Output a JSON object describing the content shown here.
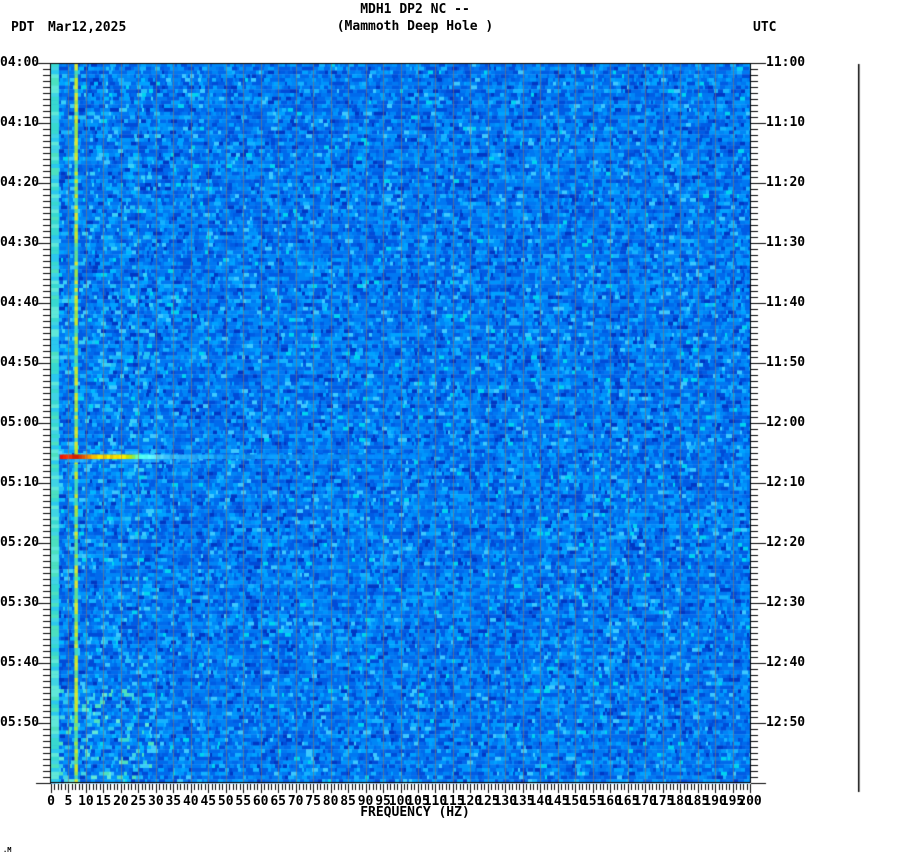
{
  "header": {
    "timezone_left": "PDT",
    "date": "Mar12,2025",
    "title": "MDH1 DP2 NC --",
    "subtitle": "(Mammoth Deep Hole )",
    "timezone_right": "UTC"
  },
  "x_axis": {
    "label": "FREQUENCY (HZ)",
    "min_hz": 0,
    "max_hz": 200,
    "major_tick_step_hz": 5,
    "minor_tick_step_hz": 1,
    "tick_labels": [
      "0",
      "5",
      "10",
      "15",
      "20",
      "25",
      "30",
      "35",
      "40",
      "45",
      "50",
      "55",
      "60",
      "65",
      "70",
      "75",
      "80",
      "85",
      "90",
      "95",
      "100",
      "105",
      "110",
      "115",
      "120",
      "125",
      "130",
      "135",
      "140",
      "145",
      "150",
      "155",
      "160",
      "165",
      "170",
      "175",
      "180",
      "185",
      "190",
      "195",
      "200"
    ]
  },
  "left_axis": {
    "timezone": "PDT",
    "major_tick_step_min": 10,
    "minor_tick_step_min": 1,
    "tick_labels": [
      "04:00",
      "04:10",
      "04:20",
      "04:30",
      "04:40",
      "04:50",
      "05:00",
      "05:10",
      "05:20",
      "05:30",
      "05:40",
      "05:50"
    ]
  },
  "right_axis": {
    "timezone": "UTC",
    "major_tick_step_min": 10,
    "minor_tick_step_min": 1,
    "tick_labels": [
      "11:00",
      "11:10",
      "11:20",
      "11:30",
      "11:40",
      "11:50",
      "12:00",
      "12:10",
      "12:20",
      "12:30",
      "12:40",
      "12:50"
    ]
  },
  "corner_text": ".M",
  "chart_data": {
    "type": "heatmap",
    "subtype": "seismic spectrogram",
    "title": "MDH1 DP2 NC --",
    "station": "(Mammoth Deep Hole )",
    "xlabel": "FREQUENCY (HZ)",
    "x_range_hz": [
      0,
      200
    ],
    "time_start_pdt": "04:00",
    "time_end_pdt": "06:00",
    "time_start_utc": "11:00",
    "time_end_utc": "13:00",
    "time_span_minutes": 120,
    "legend_position": "none",
    "grid": {
      "x_interval_hz": 5,
      "color": "#91795f"
    },
    "noise_palette": [
      [
        "#0038c4",
        1.5
      ],
      [
        "#004cd8",
        3
      ],
      [
        "#005ce4",
        5
      ],
      [
        "#006aec",
        6
      ],
      [
        "#0078f2",
        6
      ],
      [
        "#0086f6",
        5
      ],
      [
        "#0094fb",
        4
      ],
      [
        "#00a2ff",
        3
      ],
      [
        "#14b2ff",
        2
      ],
      [
        "#3cc8ff",
        1
      ],
      [
        "#00d4f0",
        0.5
      ]
    ],
    "lowfreq_cyan_palette": [
      "#38d8d0",
      "#4ce0c0",
      "#2cc8ee",
      "#60e8d8",
      "#40d4e4"
    ],
    "lowfreq_light_blue_palette": [
      "#20c0f8",
      "#38d0f8",
      "#00b8ff"
    ],
    "features": [
      {
        "name": "persistent-tone",
        "frequency_hz": 7,
        "width_hz": 0.6,
        "colors": [
          "#c8e830",
          "#9ce44c",
          "#66dd90",
          "#48d8b8",
          "#d8e838"
        ],
        "description": "continuous narrowband signal visible as yellow-green vertical line for the entire 2-hour window"
      },
      {
        "name": "low-frequency-band",
        "frequency_hz_range": [
          0,
          1.7
        ],
        "description": "bright cyan microseism band along the left (0 Hz) edge"
      },
      {
        "name": "event-burst",
        "time_pdt": "05:06",
        "time_utc": "12:06",
        "minutes_from_start": 66,
        "frequency_hz_range": [
          2.5,
          33
        ],
        "description": "brief broadband burst: red 3-10 Hz, yellow 11-21 Hz, green-cyan tail fading by ~33 Hz",
        "color_stops": [
          {
            "hz": 2.5,
            "color": "#e81000"
          },
          {
            "hz": 4,
            "color": "#ff3300"
          },
          {
            "hz": 7,
            "color": "#e02000"
          },
          {
            "hz": 10,
            "color": "#ff8800"
          },
          {
            "hz": 12,
            "color": "#ffd000"
          },
          {
            "hz": 20,
            "color": "#ffe400"
          },
          {
            "hz": 22,
            "color": "#b8e400"
          },
          {
            "hz": 25,
            "color": "#48f0d8"
          },
          {
            "hz": 30,
            "color": "#60e0ff"
          },
          {
            "hz": 33,
            "color": "#38b8ff"
          },
          {
            "hz": 50,
            "color": "#1098ff"
          },
          {
            "hz": 105,
            "color": "#0080f4"
          }
        ]
      }
    ],
    "scale_bar": {
      "side": "right",
      "color": "#000000"
    }
  }
}
